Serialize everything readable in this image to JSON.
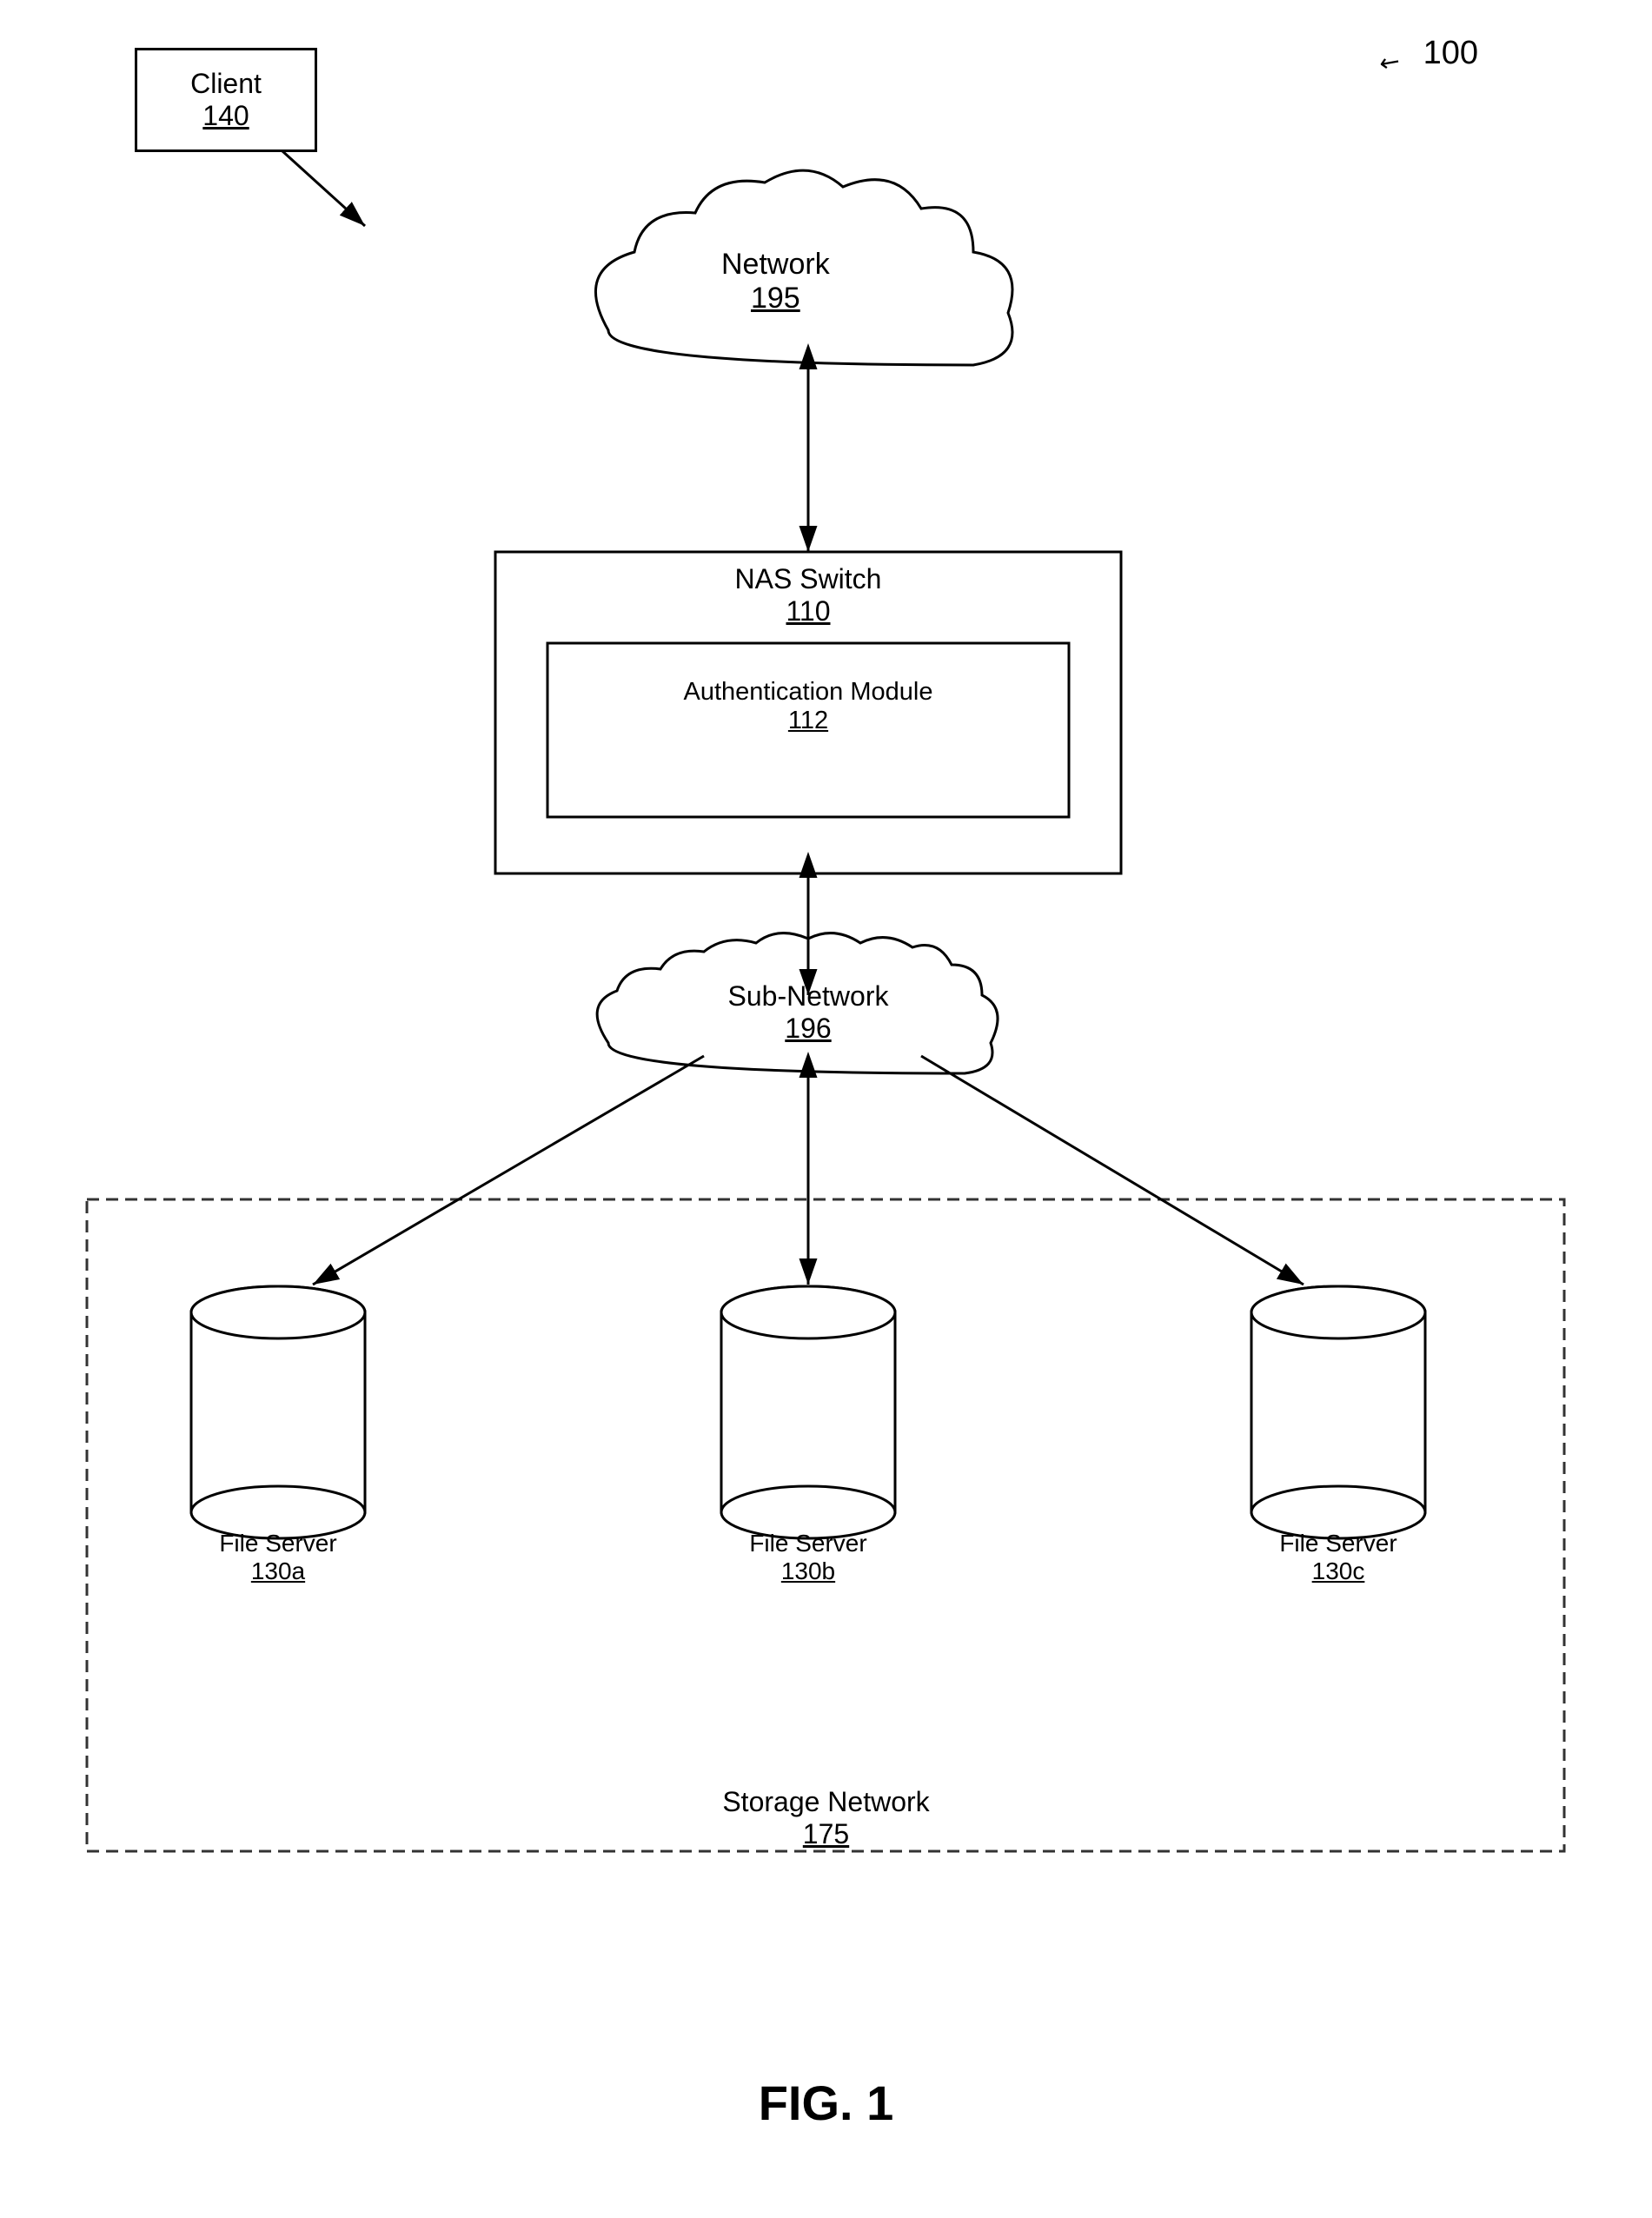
{
  "fig_ref": "100",
  "fig_label": "FIG. 1",
  "client": {
    "label": "Client",
    "number": "140"
  },
  "network": {
    "label": "Network",
    "number": "195"
  },
  "nas_switch": {
    "label": "NAS Switch",
    "number": "110"
  },
  "auth_module": {
    "label": "Authentication Module",
    "number": "112"
  },
  "sub_network": {
    "label": "Sub-Network",
    "number": "196"
  },
  "storage_network": {
    "label": "Storage Network",
    "number": "175"
  },
  "file_servers": [
    {
      "label": "File Server",
      "number": "130a"
    },
    {
      "label": "File Server",
      "number": "130b"
    },
    {
      "label": "File Server",
      "number": "130c"
    }
  ]
}
